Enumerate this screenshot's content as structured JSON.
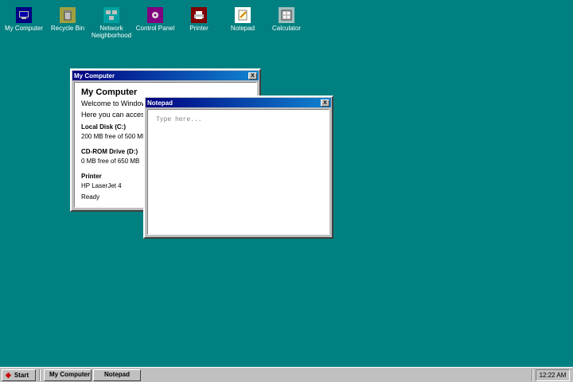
{
  "desktop_icons": [
    {
      "label": "My Computer",
      "icon": "computer-icon"
    },
    {
      "label": "Recycle Bin",
      "icon": "recycle-bin-icon"
    },
    {
      "label": "Network Neighborhood",
      "icon": "network-icon"
    },
    {
      "label": "Control Panel",
      "icon": "control-panel-icon"
    },
    {
      "label": "Printer",
      "icon": "printer-icon"
    },
    {
      "label": "Notepad",
      "icon": "notepad-icon"
    },
    {
      "label": "Calculator",
      "icon": "calculator-icon"
    }
  ],
  "my_computer": {
    "title": "My Computer",
    "close_label": "X",
    "heading": "My Computer",
    "welcome": "Welcome to Windows",
    "intro": "Here you can access",
    "drives": [
      {
        "name": "Local Disk (C:)",
        "info": "200 MB free of 500 MB"
      },
      {
        "name": "CD-ROM Drive (D:)",
        "info": "0 MB free of 650 MB"
      }
    ],
    "printer": {
      "name": "Printer",
      "model": "HP LaserJet 4",
      "status": "Ready"
    }
  },
  "notepad": {
    "title": "Notepad",
    "close_label": "X",
    "placeholder": "Type here..."
  },
  "taskbar": {
    "start_label": "Start",
    "tasks": [
      "My Computer",
      "Notepad"
    ],
    "clock": "12:22 AM"
  },
  "colors": {
    "desktop": "#008080",
    "title_active": "#000080",
    "title_gradient_end": "#1084d0",
    "start_diamond": "#cc0000"
  }
}
